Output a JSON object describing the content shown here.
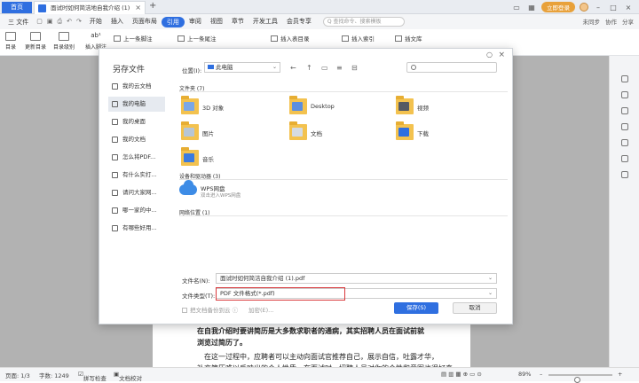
{
  "titlebar": {
    "home_tab": "首页",
    "doc_tab": "面试时如何简洁地自我介绍 (1)",
    "login": "立即登录"
  },
  "menubar": {
    "file": "三 文件",
    "items": [
      "开始",
      "插入",
      "页面布局",
      "引用",
      "审阅",
      "视图",
      "章节",
      "开发工具",
      "会员专享"
    ],
    "active_index": 3,
    "search_placeholder": "Q 查找命令、搜索模板",
    "right": [
      "未同步",
      "协作",
      "分享"
    ]
  },
  "ribbon": {
    "items": [
      "目录",
      "更新目录",
      "目录级别",
      "插入脚注"
    ],
    "prev_footnote": "上一条脚注",
    "prev_endnote": "上一条尾注",
    "insert_caption": "插入表目录",
    "insert_index": "插入索引",
    "citation": "插文库",
    "ab": "ab¹"
  },
  "dialog": {
    "title": "另存文件",
    "location_label": "位置(I):",
    "location_value": "此电脑",
    "sidebar": [
      "我的云文档",
      "我的电脑",
      "我的桌面",
      "我的文档",
      "怎么将PDF...",
      "有什么实打...",
      "请问大家网...",
      "哪一家的中...",
      "有哪些好用..."
    ],
    "selected_sidebar": 1,
    "folders_section": "文件夹 (7)",
    "folders": [
      {
        "name": "3D 对象",
        "badge": "#7aa7e8"
      },
      {
        "name": "Desktop",
        "badge": "#5a8ee0"
      },
      {
        "name": "视频",
        "badge": "#555a63"
      },
      {
        "name": "图片",
        "badge": "#b7c6d6"
      },
      {
        "name": "文档",
        "badge": "#d5dbe3"
      },
      {
        "name": "下载",
        "badge": "#2f6fe0"
      },
      {
        "name": "音乐",
        "badge": "#3b7be0"
      }
    ],
    "devices_section": "设备和驱动器 (3)",
    "device_name": "WPS网盘",
    "device_desc": "双击进入WPS网盘",
    "network_section": "网络位置 (1)",
    "filename_label": "文件名(N):",
    "filename_value": "面试时如何简洁自我介绍 (1).pdf",
    "filetype_label": "文件类型(T):",
    "filetype_value": "PDF 文件格式(*.pdf)",
    "backup_label": "把文档备份到云",
    "encrypt_label": "加密(E)...",
    "save_label": "保存(S)",
    "cancel_label": "取消"
  },
  "document": {
    "line1": "在自我介绍时要讲简历是大多数求职者的通病，其实招聘人员在面试前就",
    "line2": "浏览过简历了。",
    "line3": "在这一过程中，应聘者可以主动向面试官推荐自己，展示自信，吐露才华，",
    "line4": "补充简历难以反映出的个人性质。在面试时，招聘人员对你的个性和意图也很好奇"
  },
  "status": {
    "page": "页面: 1/3",
    "words": "字数: 1249",
    "spell": "拼写检查",
    "doc_check": "文档校对",
    "zoom": "89%",
    "zoom_level": 0.45
  }
}
